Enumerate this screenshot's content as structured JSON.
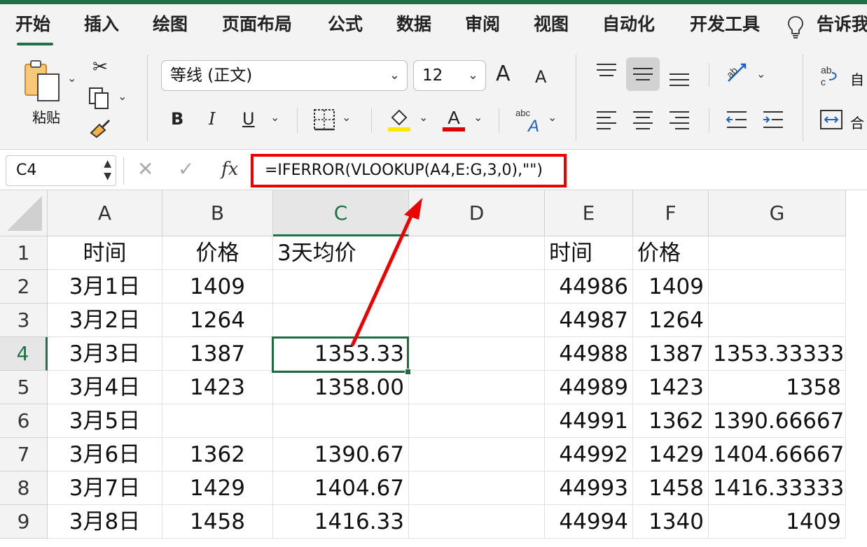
{
  "ribbon_tabs": [
    "开始",
    "插入",
    "绘图",
    "页面布局",
    "公式",
    "数据",
    "审阅",
    "视图",
    "自动化",
    "开发工具",
    "告诉我"
  ],
  "ribbon": {
    "paste_label": "粘贴",
    "font_name": "等线 (正文)",
    "font_size": "12",
    "bold": "B",
    "italic": "I",
    "underline": "U",
    "grow_font": "A",
    "shrink_font": "A",
    "wrap_text_label": "自",
    "merge_label": "合"
  },
  "formula_bar": {
    "name_box": "C4",
    "cancel_symbol": "✕",
    "confirm_symbol": "✓",
    "fx_label": "fx",
    "formula": "=IFERROR(VLOOKUP(A4,E:G,3,0),\"\")"
  },
  "columns": [
    "A",
    "B",
    "C",
    "D",
    "E",
    "F",
    "G"
  ],
  "selected_cell": "C4",
  "rows": [
    {
      "n": "1",
      "A": "时间",
      "B": "价格",
      "C": "3天均价",
      "D": "",
      "E": "时间",
      "F": "价格",
      "G": ""
    },
    {
      "n": "2",
      "A": "3月1日",
      "B": "1409",
      "C": "",
      "D": "",
      "E": "44986",
      "F": "1409",
      "G": ""
    },
    {
      "n": "3",
      "A": "3月2日",
      "B": "1264",
      "C": "",
      "D": "",
      "E": "44987",
      "F": "1264",
      "G": ""
    },
    {
      "n": "4",
      "A": "3月3日",
      "B": "1387",
      "C": "1353.33",
      "D": "",
      "E": "44988",
      "F": "1387",
      "G": "1353.33333"
    },
    {
      "n": "5",
      "A": "3月4日",
      "B": "1423",
      "C": "1358.00",
      "D": "",
      "E": "44989",
      "F": "1423",
      "G": "1358"
    },
    {
      "n": "6",
      "A": "3月5日",
      "B": "",
      "C": "",
      "D": "",
      "E": "44991",
      "F": "1362",
      "G": "1390.66667"
    },
    {
      "n": "7",
      "A": "3月6日",
      "B": "1362",
      "C": "1390.67",
      "D": "",
      "E": "44992",
      "F": "1429",
      "G": "1404.66667"
    },
    {
      "n": "8",
      "A": "3月7日",
      "B": "1429",
      "C": "1404.67",
      "D": "",
      "E": "44993",
      "F": "1458",
      "G": "1416.33333"
    },
    {
      "n": "9",
      "A": "3月8日",
      "B": "1458",
      "C": "1416.33",
      "D": "",
      "E": "44994",
      "F": "1340",
      "G": "1409"
    }
  ],
  "colors": {
    "accent": "#1e7145",
    "annotation_red": "#ef0000",
    "font_color_bar": "#e00000",
    "highlight_bar": "#ffe800"
  }
}
